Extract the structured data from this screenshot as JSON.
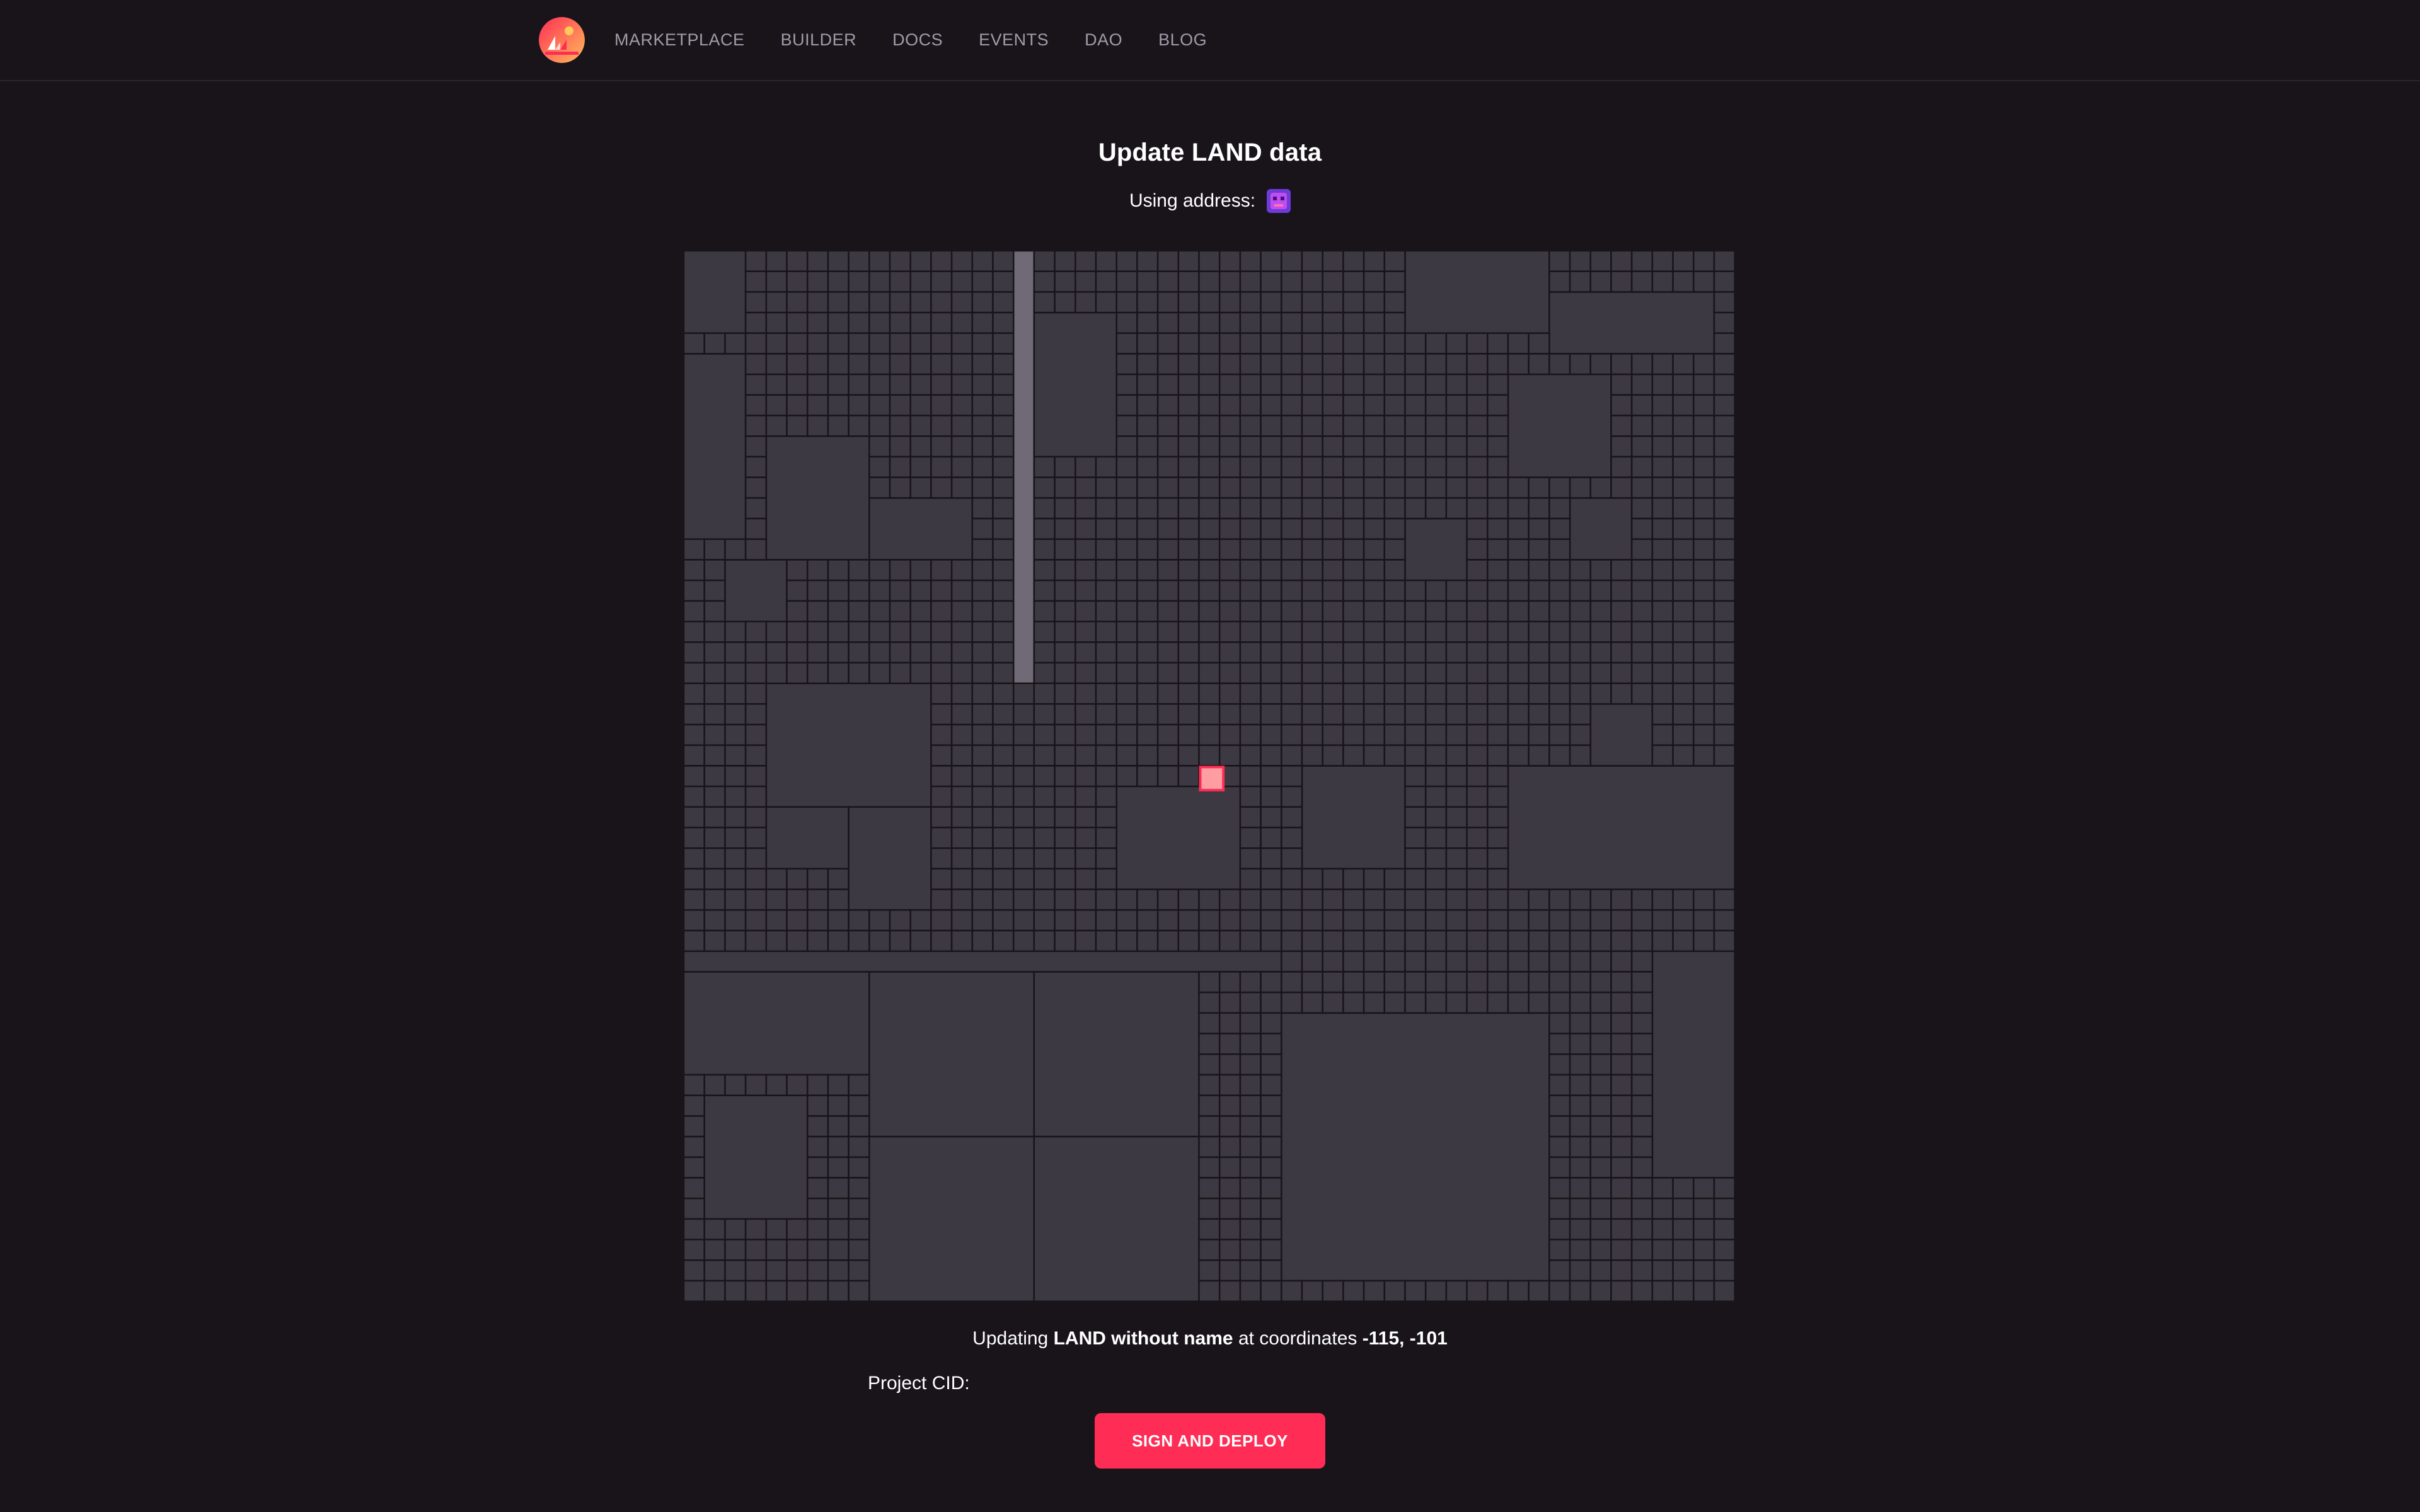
{
  "nav": {
    "items": [
      {
        "label": "MARKETPLACE"
      },
      {
        "label": "BUILDER"
      },
      {
        "label": "DOCS"
      },
      {
        "label": "EVENTS"
      },
      {
        "label": "DAO"
      },
      {
        "label": "BLOG"
      }
    ]
  },
  "page": {
    "title": "Update LAND data",
    "address_label": "Using address:"
  },
  "status": {
    "prefix": "Updating",
    "land_name": "LAND without name",
    "middle": "at coordinates",
    "coords": "-115, -101"
  },
  "form": {
    "cid_label": "Project CID:",
    "cid_value": "",
    "submit_label": "SIGN AND DEPLOY"
  },
  "colors": {
    "background": "#18141a",
    "parcel": "#3d3942",
    "parcel_border": "#18141a",
    "road": "#6f6a76",
    "selected": "#ff9ea2",
    "accent": "#ff2d55"
  },
  "icons": {
    "logo": "decentraland-logo-icon",
    "avatar": "user-avatar-icon"
  }
}
